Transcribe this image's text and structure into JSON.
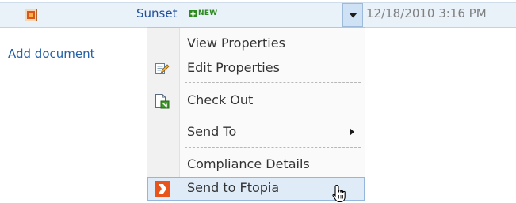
{
  "list_row": {
    "doc_icon": "document-type-icon",
    "title": "Sunset",
    "new_badge": "NEW",
    "new_icon": "new-plus-icon",
    "menu_button_icon": "dropdown-arrow-icon",
    "modified": "12/18/2010 3:16 PM"
  },
  "add_document": "Add document",
  "context_menu": {
    "items": [
      {
        "label": "View Properties",
        "icon": ""
      },
      {
        "label": "Edit Properties",
        "icon": "edit-properties-icon"
      },
      {
        "label": "Check Out",
        "icon": "check-out-icon"
      },
      {
        "label": "Send To",
        "icon": "",
        "submenu_icon": "submenu-arrow-icon"
      },
      {
        "label": "Compliance Details",
        "icon": ""
      },
      {
        "label": "Send to Ftopia",
        "icon": "ftopia-icon",
        "state": "hover"
      }
    ]
  },
  "cursor_icon": "hand-pointer-icon",
  "colors": {
    "row_background": "#e9f1f9",
    "link": "#2361a8",
    "hover_background": "#dfecf8",
    "hover_border": "#93b6dc",
    "ftopia_orange": "#e8541b",
    "new_green": "#2c8a1f"
  }
}
